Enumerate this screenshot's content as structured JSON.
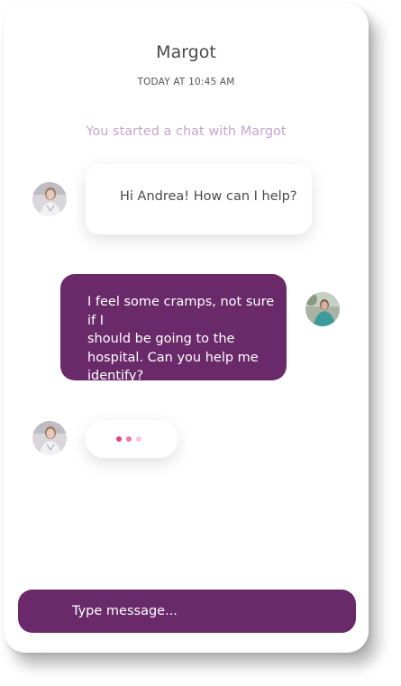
{
  "header": {
    "title": "Margot",
    "timestamp": "TODAY AT 10:45 AM"
  },
  "system_message": "You started a chat with Margot",
  "messages": [
    {
      "direction": "incoming",
      "sender": "Margot",
      "text": "Hi Andrea! How can I help?",
      "avatar_icon": "agent-avatar"
    },
    {
      "direction": "outgoing",
      "sender": "Andrea",
      "lines": [
        "I feel some cramps, not sure if I",
        "should be going to the",
        "hospital. Can you help me",
        "identify?"
      ],
      "avatar_icon": "user-avatar"
    }
  ],
  "typing_indicator": {
    "sender": "Margot",
    "dot_colors": [
      "#e0457b",
      "#ee7aa0",
      "#f8c8d8"
    ]
  },
  "composer": {
    "placeholder": "Type message..."
  },
  "colors": {
    "accent": "#6a2a6a",
    "system_text": "#c5a5cf",
    "card": "#ffffff"
  }
}
